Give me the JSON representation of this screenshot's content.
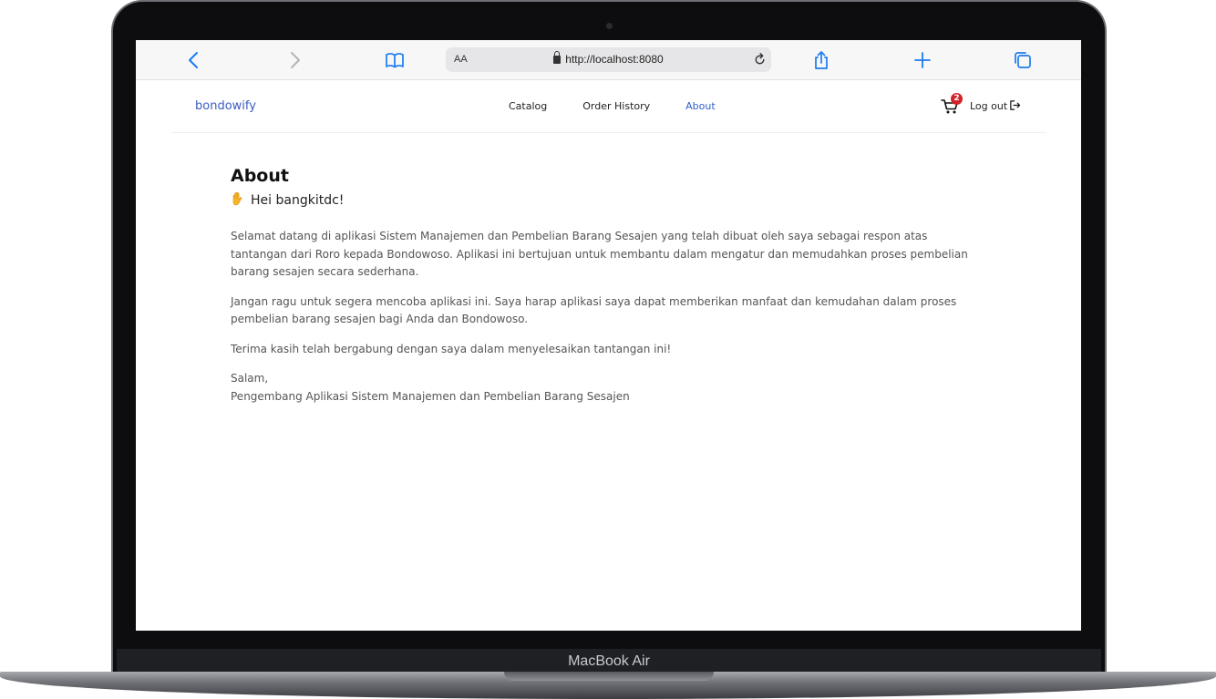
{
  "device": {
    "model_label": "MacBook Air"
  },
  "browser": {
    "text_size_label": "AA",
    "url": "http://localhost:8080"
  },
  "nav": {
    "brand": "bondowify",
    "links": [
      {
        "label": "Catalog",
        "active": false
      },
      {
        "label": "Order History",
        "active": false
      },
      {
        "label": "About",
        "active": true
      }
    ],
    "cart_count": "2",
    "logout_label": "Log out"
  },
  "about": {
    "title": "About",
    "greeting": "Hei bangkitdc!",
    "paragraphs": [
      "Selamat datang di aplikasi Sistem Manajemen dan Pembelian Barang Sesajen yang telah dibuat oleh saya sebagai respon atas tantangan dari Roro kepada Bondowoso. Aplikasi ini bertujuan untuk membantu dalam mengatur dan memudahkan proses pembelian barang sesajen secara sederhana.",
      "Jangan ragu untuk segera mencoba aplikasi ini. Saya harap aplikasi saya dapat memberikan manfaat dan kemudahan dalam proses pembelian barang sesajen bagi Anda dan Bondowoso.",
      "Terima kasih telah bergabung dengan saya dalam menyelesaikan tantangan ini!"
    ],
    "closing": "Salam,",
    "signature": "Pengembang Aplikasi Sistem Manajemen dan Pembelian Barang Sesajen"
  },
  "colors": {
    "brand": "#3a5bbf",
    "active_link": "#2f5fd0",
    "badge": "#d5212a",
    "safari_blue": "#1a7cf0"
  }
}
